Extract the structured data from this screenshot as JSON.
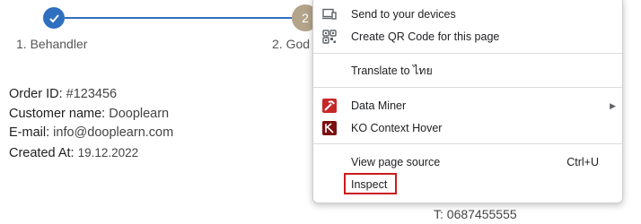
{
  "stepper": {
    "step1_label": "1. Behandler",
    "step2_number": "2",
    "step2_label": "2. God"
  },
  "order": {
    "id_label": "Order ID:",
    "id_value": "#123456",
    "name_label": "Customer name:",
    "name_value": "Dooplearn",
    "email_label": "E-mail:",
    "email_value": "info@dooplearn.com",
    "created_label": "Created At:",
    "created_value": "19.12.2022"
  },
  "contact": {
    "phone": "T: 0687455555"
  },
  "context_menu": {
    "send_to_devices": "Send to your devices",
    "create_qr": "Create QR Code for this page",
    "translate": "Translate to ไทย",
    "data_miner": "Data Miner",
    "ko_context_hover": "KO Context Hover",
    "view_source": "View page source",
    "view_source_shortcut": "Ctrl+U",
    "inspect": "Inspect"
  },
  "colors": {
    "stepper_blue": "#2f6fbf",
    "highlight_red": "#cc1b1b"
  }
}
